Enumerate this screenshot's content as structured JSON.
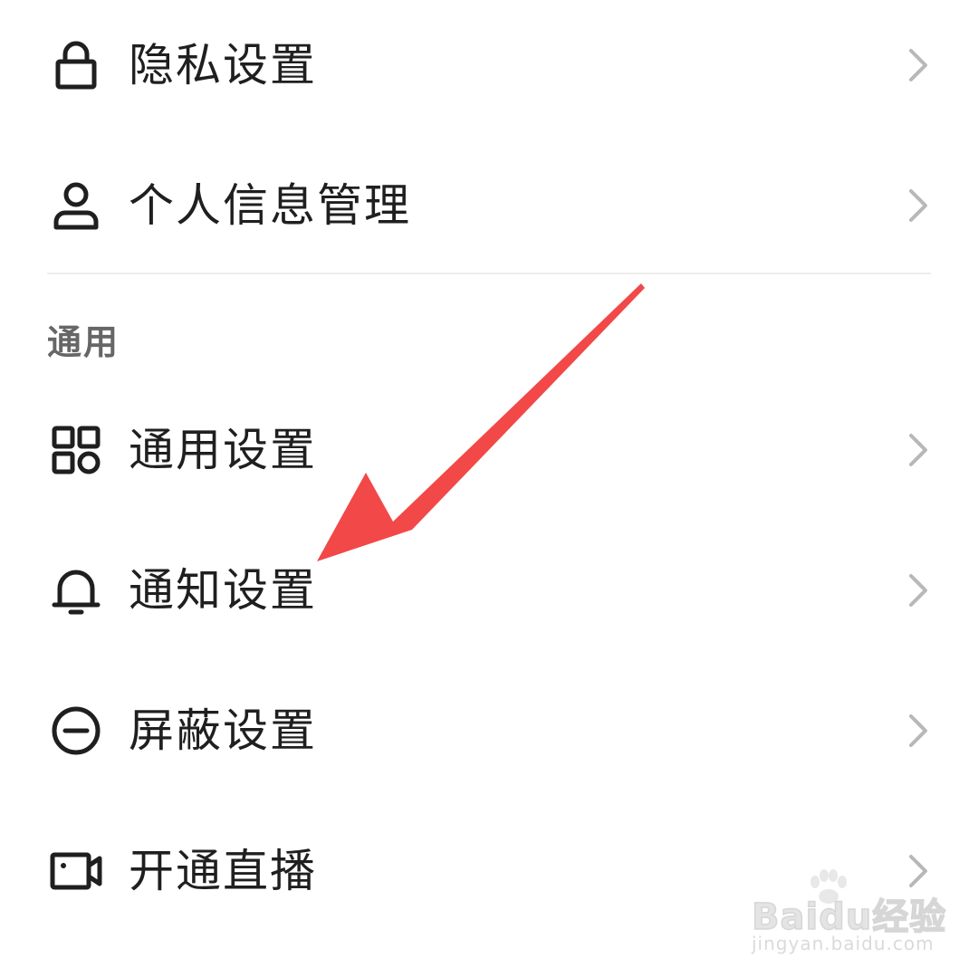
{
  "settings_top": {
    "items": [
      {
        "label": "隐私设置",
        "icon": "lock-icon"
      },
      {
        "label": "个人信息管理",
        "icon": "user-icon"
      }
    ]
  },
  "general_section": {
    "header": "通用",
    "items": [
      {
        "label": "通用设置",
        "icon": "grid-icon"
      },
      {
        "label": "通知设置",
        "icon": "bell-icon"
      },
      {
        "label": "屏蔽设置",
        "icon": "block-icon"
      },
      {
        "label": "开通直播",
        "icon": "video-camera-icon"
      }
    ]
  },
  "annotation": {
    "arrow_color": "#f24848",
    "points_to": "通知设置"
  },
  "watermark": {
    "logo": "Baidu经验",
    "url": "jingyan.baidu.com"
  }
}
